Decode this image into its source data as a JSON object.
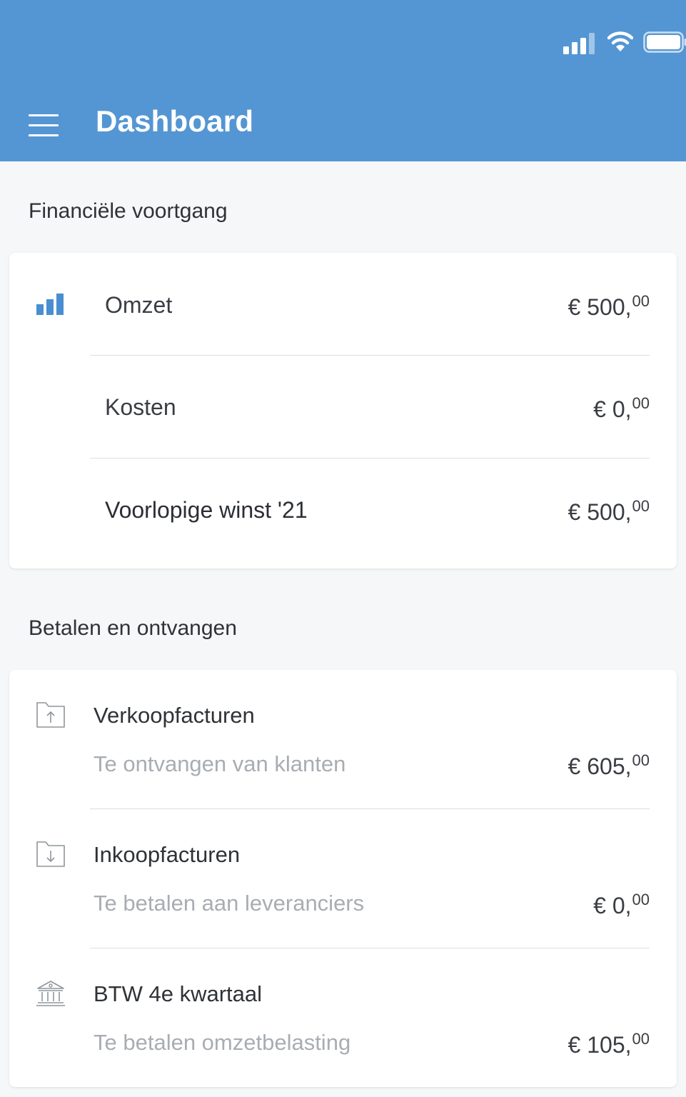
{
  "header": {
    "title": "Dashboard",
    "accent_color": "#5496d3"
  },
  "status_bar": {
    "icons": [
      "cellular-signal-icon",
      "wifi-icon",
      "battery-icon"
    ]
  },
  "financial_progress": {
    "title": "Financiële voortgang",
    "rows": [
      {
        "label": "Omzet",
        "amount_main": "€ 500,",
        "amount_cents": "00",
        "icon": "bar-chart-icon"
      },
      {
        "label": "Kosten",
        "amount_main": "€ 0,",
        "amount_cents": "00"
      },
      {
        "label": "Voorlopige winst '21",
        "amount_main": "€ 500,",
        "amount_cents": "00"
      }
    ]
  },
  "pay_receive": {
    "title": "Betalen en ontvangen",
    "items": [
      {
        "title": "Verkoopfacturen",
        "subtitle": "Te ontvangen van klanten",
        "amount_main": "€ 605,",
        "amount_cents": "00",
        "icon": "folder-upload-icon"
      },
      {
        "title": "Inkoopfacturen",
        "subtitle": "Te betalen aan leveranciers",
        "amount_main": "€ 0,",
        "amount_cents": "00",
        "icon": "folder-download-icon"
      },
      {
        "title": "BTW 4e kwartaal",
        "subtitle": "Te betalen omzetbelasting",
        "amount_main": "€ 105,",
        "amount_cents": "00",
        "icon": "bank-icon"
      }
    ]
  }
}
